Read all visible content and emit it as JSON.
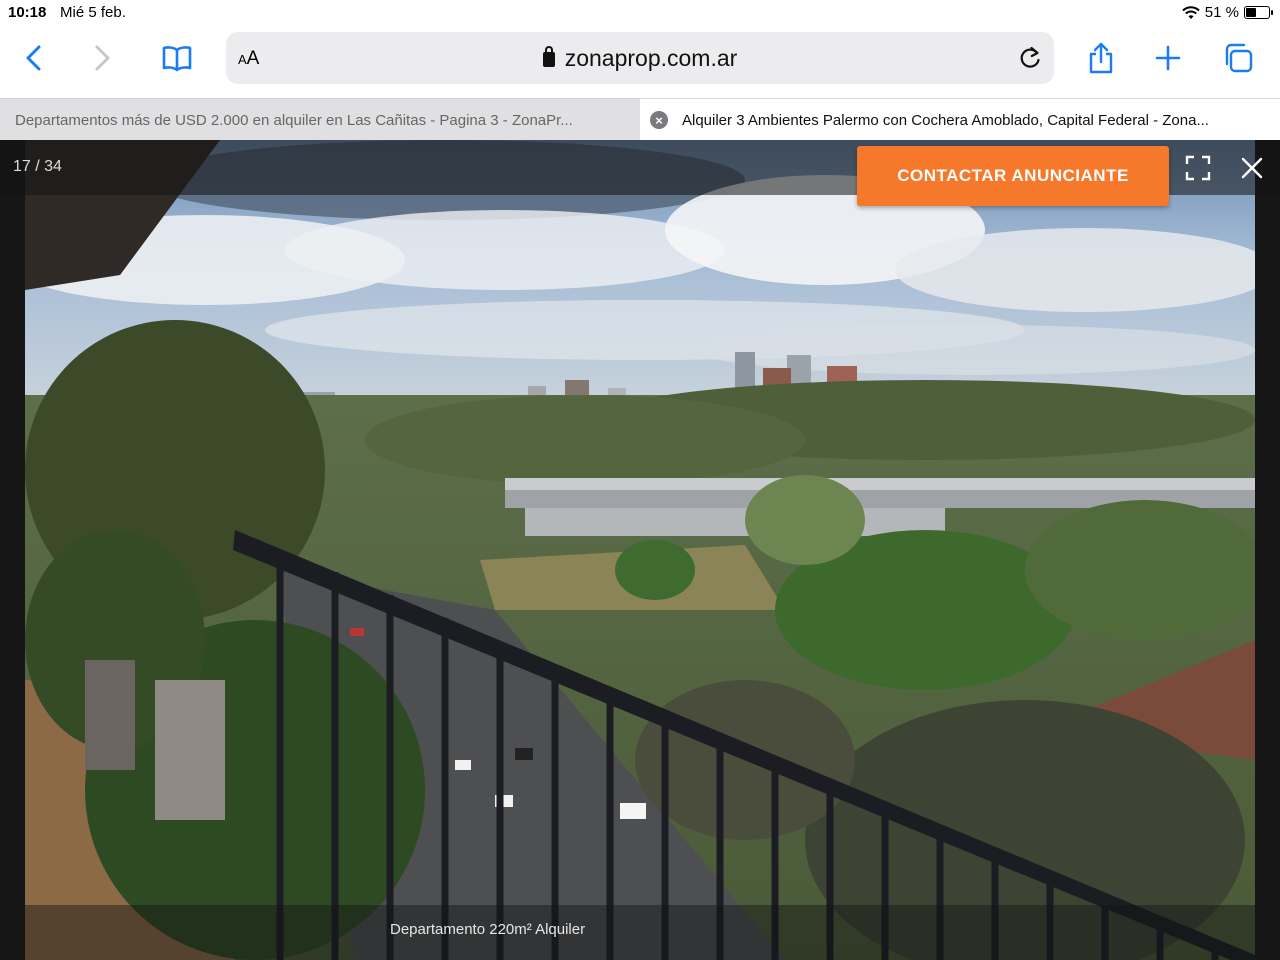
{
  "status_bar": {
    "time": "10:18",
    "date": "Mié 5 feb.",
    "battery_text": "51 %",
    "battery_level": 0.51
  },
  "toolbar": {
    "text_size_label": "AA",
    "url": "zonaprop.com.ar",
    "icons": [
      "back-icon",
      "forward-icon",
      "bookmarks-icon",
      "lock-icon",
      "reload-icon",
      "share-icon",
      "new-tab-icon",
      "tabs-icon"
    ]
  },
  "tabs": [
    {
      "title": "Departamentos más de USD 2.000 en alquiler en Las Cañitas - Pagina 3 - ZonaPr..."
    },
    {
      "title": "Alquiler 3 Ambientes Palermo con Cochera Amoblado, Capital Federal - Zona..."
    }
  ],
  "viewer": {
    "counter": "17 / 34",
    "contact_button": "CONTACTAR ANUNCIANTE",
    "caption": "Departamento 220m² Alquiler",
    "accent_color": "#f6792b"
  }
}
